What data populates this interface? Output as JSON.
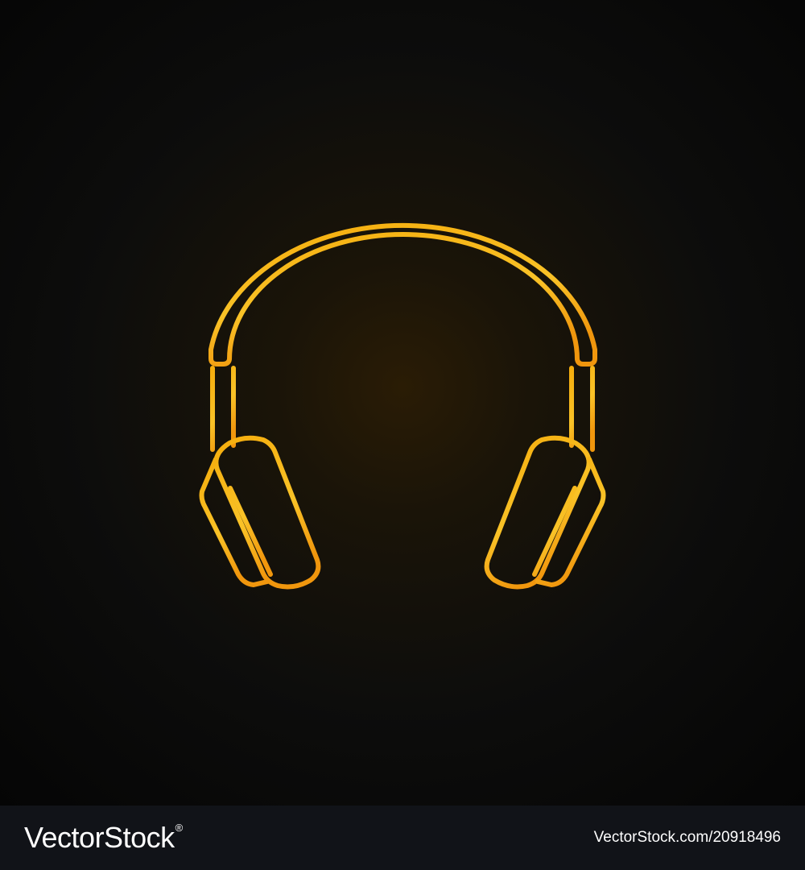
{
  "illustration": {
    "subject": "headphones-icon",
    "style": "outline",
    "background_color": "#0d0d0c",
    "stroke_gradient": [
      "#f5ad0d",
      "#f9c227",
      "#f0960d"
    ]
  },
  "footer": {
    "brand_name": "VectorStock",
    "brand_mark": "®",
    "image_id": "VectorStock.com/20918496",
    "background_color": "#111318",
    "text_color": "#ffffff"
  }
}
